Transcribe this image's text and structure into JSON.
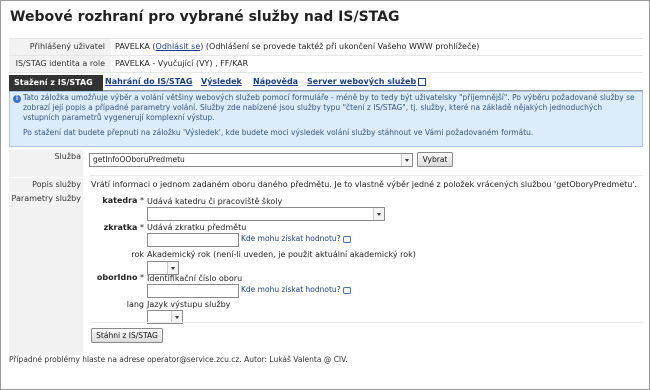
{
  "title": "Webové rozhraní pro vybrané služby nad IS/STAG",
  "header": {
    "user_label": "Přihlášený uživatel",
    "user_name": "PAVELKA",
    "logout_open": "(",
    "logout_link": "Odhlásit se",
    "logout_note": ") (Odhlášení se provede taktéž při ukončení Vašeho WWW prohlížeče)",
    "identity_label": "IS/STAG identita a role",
    "identity_value": "PAVELKA - Vyučující (VY) , FF/KAR"
  },
  "tabs": [
    {
      "label": "Stažení z IS/STAG",
      "active": true
    },
    {
      "label": "Nahrání do IS/STAG",
      "active": false
    },
    {
      "label": "Výsledek",
      "active": false
    },
    {
      "label": "Nápověda",
      "active": false
    },
    {
      "label": "Server webových služeb",
      "active": false
    }
  ],
  "info": {
    "icon": "info-icon",
    "line1": "Tato záložka umožňuje výběr a volání většiny webových služeb pomocí formuláře - méně by to tedy být uživatelsky \"příjemnější\". Po výběru požadované služby se zobrazí její popis a případné parametry volání. Služby zde nabízené jsou služby typu \"čtení z IS/STAG\", tj. služby, které na základě nějakých jednoduchých vstupních parametrů vygenerují komplexní výstup.",
    "line2": "Po stažení dat budete přepnuti na záložku 'Výsledek', kde budete moci výsledek volání služby stáhnout ve Vámi požadovaném formátu."
  },
  "form": {
    "service_label": "Služba",
    "service_value": "getInfoOOboruPredmetu",
    "select_button": "Vybrat",
    "desc_label": "Popis služby",
    "desc_text": "Vrátí informaci o jednom zadaném oboru daného předmětu. Je to vlastně výběr jedné z položek vrácených službou 'getOboryPredmetu'.",
    "params_label": "Parametry služby",
    "params": [
      {
        "name": "katedra",
        "required_mark": " *",
        "desc": "Udává katedru či pracoviště školy",
        "hint": ""
      },
      {
        "name": "zkratka",
        "required_mark": " *",
        "desc": "Udává zkratku předmětu",
        "hint": "Kde mohu získat hodnotu?"
      },
      {
        "name": "rok",
        "required_mark": "",
        "desc": "Akademický rok (není-li uveden, je použit aktuální akademický rok)",
        "hint": ""
      },
      {
        "name": "oborIdno",
        "required_mark": " *",
        "desc": "Identifikační číslo oboru",
        "hint": "Kde mohu získat hodnotu?"
      },
      {
        "name": "lang",
        "required_mark": "",
        "desc": "Jazyk výstupu služby",
        "hint": ""
      }
    ],
    "submit_button": "Stáhni z IS/STAG"
  },
  "footer": "Případné problémy hlaste na adrese operator@service.zcu.cz. Autor: Lukáš Valenta @ CIV."
}
